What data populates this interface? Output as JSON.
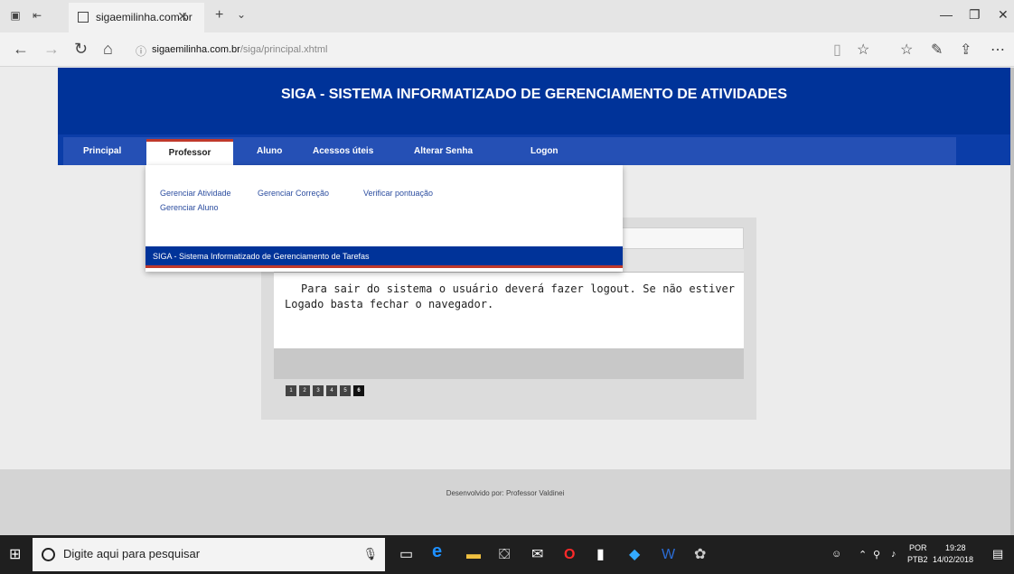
{
  "browser": {
    "tab_title": "sigaemilinha.com.br",
    "url_host": "sigaemilinha.com.br",
    "url_path": "/siga/principal.xhtml"
  },
  "site": {
    "banner_title": "SIGA - SISTEMA INFORMATIZADO DE GERENCIAMENTO DE ATIVIDADES",
    "nav": [
      "Principal",
      "Professor",
      "Aluno",
      "Acessos úteis",
      "Alterar Senha",
      "Logon"
    ],
    "active_nav": "Professor",
    "dropdown_links": [
      "Gerenciar Atividade",
      "Gerenciar Correção",
      "Verificar pontuação",
      "Gerenciar Aluno"
    ],
    "dropdown_footer": "SIGA - Sistema Informatizado de Gerenciamento de Tarefas",
    "panel_text": "Para sair do sistema o usuário deverá fazer logout. Se não estiver Logado basta fechar o navegador.",
    "pager": [
      "1",
      "2",
      "3",
      "4",
      "5",
      "6"
    ],
    "pager_current": "6",
    "footer": "Desenvolvido por: Professor Valdinei"
  },
  "taskbar": {
    "search_placeholder": "Digite aqui para pesquisar",
    "lang_line1": "POR",
    "lang_line2": "PTB2",
    "time": "19:28",
    "date": "14/02/2018"
  },
  "colors": {
    "banner": "#003399",
    "nav": "#2550b5",
    "accent_red": "#c0392b"
  }
}
